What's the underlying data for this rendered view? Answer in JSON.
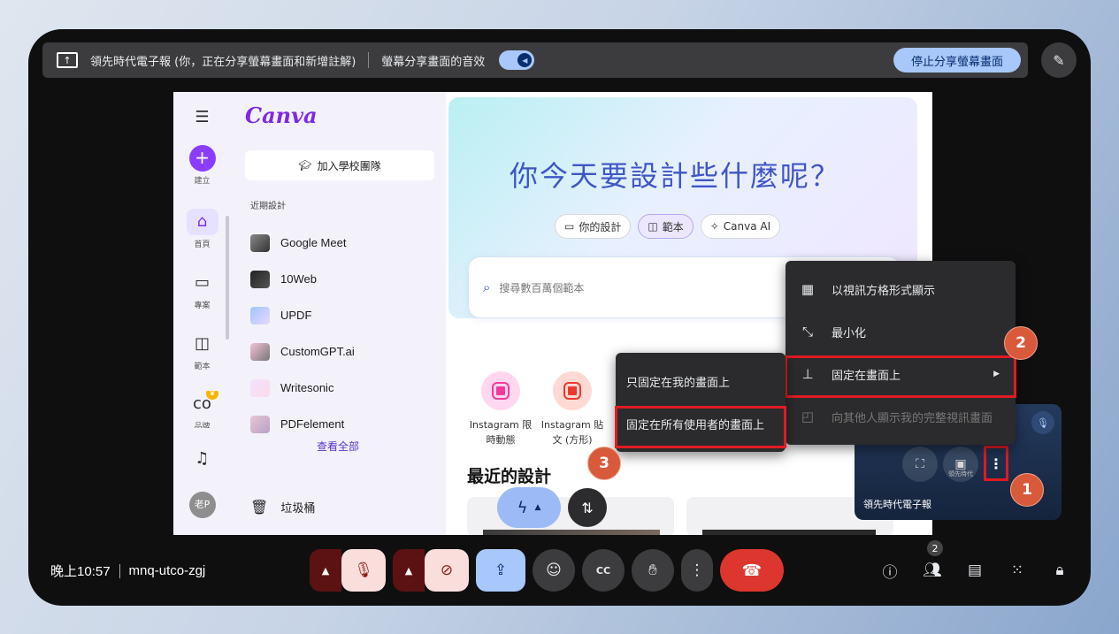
{
  "share_bar": {
    "message": "領先時代電子報 (你，正在分享螢幕畫面和新增註解)",
    "audio_label": "螢幕分享畫面的音效",
    "stop_button": "停止分享螢幕畫面",
    "audio_on": true
  },
  "canva": {
    "logo": "Canva",
    "rail": [
      {
        "name": "create",
        "label": "建立",
        "icon": "plus-icon"
      },
      {
        "name": "home",
        "label": "首頁",
        "icon": "home-icon",
        "active": true
      },
      {
        "name": "projects",
        "label": "專案",
        "icon": "folder-icon"
      },
      {
        "name": "templates",
        "label": "範本",
        "icon": "template-icon"
      },
      {
        "name": "brand",
        "label": "品牌",
        "icon": "brand-icon"
      },
      {
        "name": "notifications",
        "label": "",
        "icon": "bell-icon"
      },
      {
        "name": "account",
        "label": "老P",
        "icon": "avatar"
      }
    ],
    "join_button": "加入學校團隊",
    "recent_label": "近期設計",
    "recent_items": [
      "Google Meet",
      "10Web",
      "UPDF",
      "CustomGPT.ai",
      "Writesonic",
      "PDFelement"
    ],
    "see_all": "查看全部",
    "trash": "垃圾桶",
    "hero_title": "你今天要設計些什麼呢？",
    "pills": [
      "你的設計",
      "範本",
      "Canva AI"
    ],
    "search_placeholder": "搜尋數百萬個範本",
    "templates": [
      {
        "line1": "Instagram 限",
        "line2": "時動態"
      },
      {
        "line1": "Instagram 貼",
        "line2": "文 (方形)"
      }
    ],
    "recent_heading": "最近的設計"
  },
  "menu_main": {
    "items": [
      {
        "label": "以視訊方格形式顯示",
        "icon": "grid-icon",
        "enabled": true
      },
      {
        "label": "最小化",
        "icon": "minimize-icon",
        "enabled": true
      },
      {
        "label": "固定在畫面上",
        "icon": "pin-icon",
        "enabled": true,
        "submenu": true
      },
      {
        "label": "向其他人顯示我的完整視訊畫面",
        "icon": "frame-icon",
        "enabled": false
      }
    ]
  },
  "menu_sub": {
    "items": [
      "只固定在我的畫面上",
      "固定在所有使用者的畫面上"
    ]
  },
  "self_tile": {
    "name": "領先時代電子報",
    "tiny_label": "領先時代"
  },
  "callouts": [
    "1",
    "2",
    "3"
  ],
  "bottom": {
    "time": "晚上10:57",
    "meeting_code": "mnq-utco-zgj",
    "participants_count": "2"
  },
  "colors": {
    "accent": "#a8c7fa",
    "hangup": "#dc362e",
    "highlight": "#e01b22",
    "callout": "#d9593b",
    "canva_purple": "#7d2ae8"
  }
}
